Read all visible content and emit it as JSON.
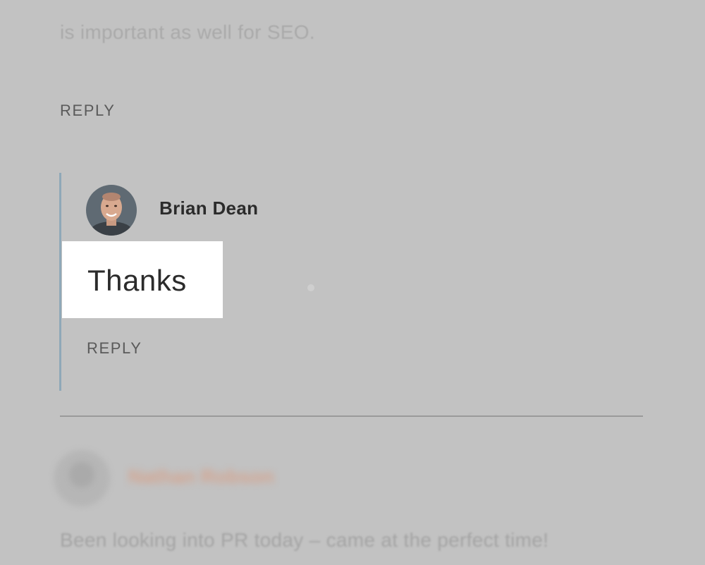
{
  "previous_comment": {
    "text_tail": "is important as well for SEO.",
    "reply_label": "REPLY"
  },
  "nested_reply": {
    "author": "Brian Dean",
    "comment": "Thanks",
    "reply_label": "REPLY",
    "thread_bar_color": "#8fa8b8",
    "highlight_color": "#ffffff"
  },
  "next_comment": {
    "author": "Nathan Robson",
    "text": "Been looking into PR today – came at the perfect time!",
    "author_color": "#d4a48f"
  },
  "overlay_color": "#c2c2c2"
}
